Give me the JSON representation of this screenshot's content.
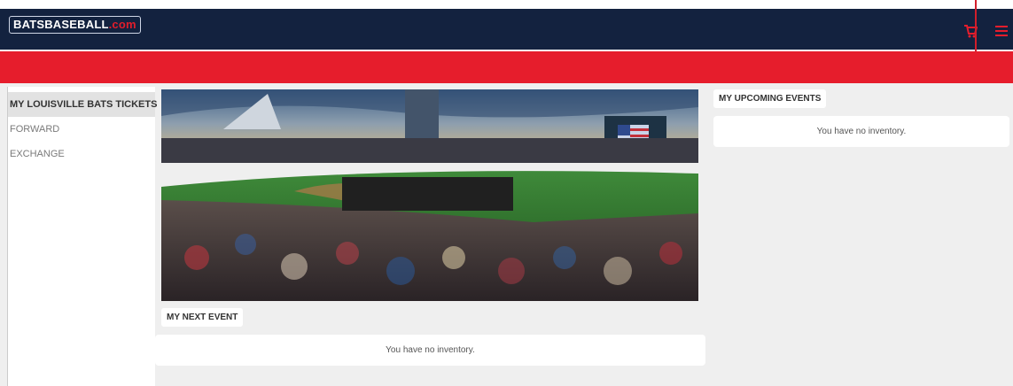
{
  "header": {
    "logo_main": "BATSBASEBALL",
    "logo_domain": ".com",
    "cart_icon": "cart-icon",
    "menu_icon": "hamburger-menu-icon"
  },
  "sidebar": {
    "items": [
      {
        "label": "MY LOUISVILLE BATS TICKETS"
      },
      {
        "label": "FORWARD"
      },
      {
        "label": "EXCHANGE"
      }
    ]
  },
  "main": {
    "hero_image": "ballpark-crowd-photo",
    "next_event": {
      "title": "MY NEXT EVENT",
      "empty_message": "You have no inventory."
    },
    "upcoming_events": {
      "title": "MY UPCOMING EVENTS",
      "empty_message": "You have no inventory."
    }
  },
  "colors": {
    "navy": "#13223f",
    "red": "#e61d2c",
    "background": "#efefef"
  }
}
